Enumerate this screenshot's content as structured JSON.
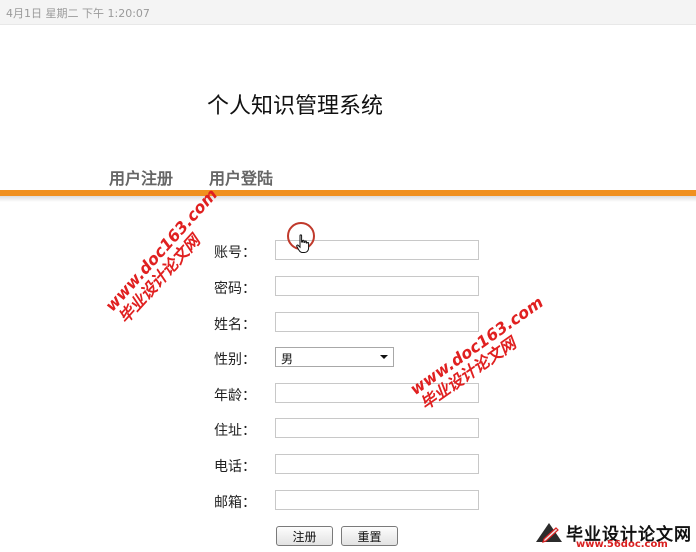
{
  "status_bar": {
    "datetime": "4月1日  星期二  下午   1:20:07"
  },
  "header": {
    "title": "个人知识管理系统"
  },
  "nav": {
    "register": "用户注册",
    "login": "用户登陆"
  },
  "form": {
    "account_label": "账号：",
    "password_label": "密码：",
    "name_label": "姓名：",
    "gender_label": "性别：",
    "gender_value": "男",
    "age_label": "年龄：",
    "address_label": "住址：",
    "phone_label": "电话：",
    "email_label": "邮箱：",
    "submit_label": "注册",
    "reset_label": "重置"
  },
  "watermarks": {
    "a_line1": "www.doc163.com",
    "a_line2": "毕业设计论文网",
    "b_line1": "www.doc163.com",
    "b_line2": "毕业设计论文网"
  },
  "logo": {
    "title": "毕业设计论文网",
    "url": "www.56doc.com"
  },
  "colors": {
    "accent_orange": "#f0901f",
    "watermark_red": "#e02020"
  }
}
